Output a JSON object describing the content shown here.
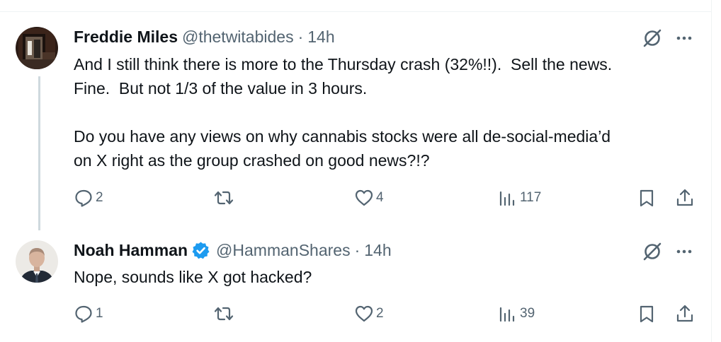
{
  "tweets": [
    {
      "author": {
        "name": "Freddie Miles",
        "handle": "@thetwitabides",
        "verified": false
      },
      "time": "14h",
      "separator": "·",
      "text": "And I still think there is more to the Thursday crash (32%!!).  Sell the news.\nFine.  But not 1/3 of the value in 3 hours.\n\nDo you have any views on why cannabis stocks were all de-social-media’d\non X right as the group crashed on good news?!?",
      "stats": {
        "replies": "2",
        "reposts": "",
        "likes": "4",
        "views": "117"
      }
    },
    {
      "author": {
        "name": "Noah Hamman",
        "handle": "@HammanShares",
        "verified": true
      },
      "time": "14h",
      "separator": "·",
      "text": "Nope, sounds like X got hacked?",
      "stats": {
        "replies": "1",
        "reposts": "",
        "likes": "2",
        "views": "39"
      }
    }
  ],
  "colors": {
    "text_primary": "#0f1419",
    "text_secondary": "#536471",
    "verified_blue": "#1d9bf0",
    "thread_line": "#cfd9de"
  },
  "icons": [
    "reply-icon",
    "repost-icon",
    "like-icon",
    "views-icon",
    "bookmark-icon",
    "share-icon",
    "grok-icon",
    "more-icon",
    "verified-badge-icon"
  ]
}
